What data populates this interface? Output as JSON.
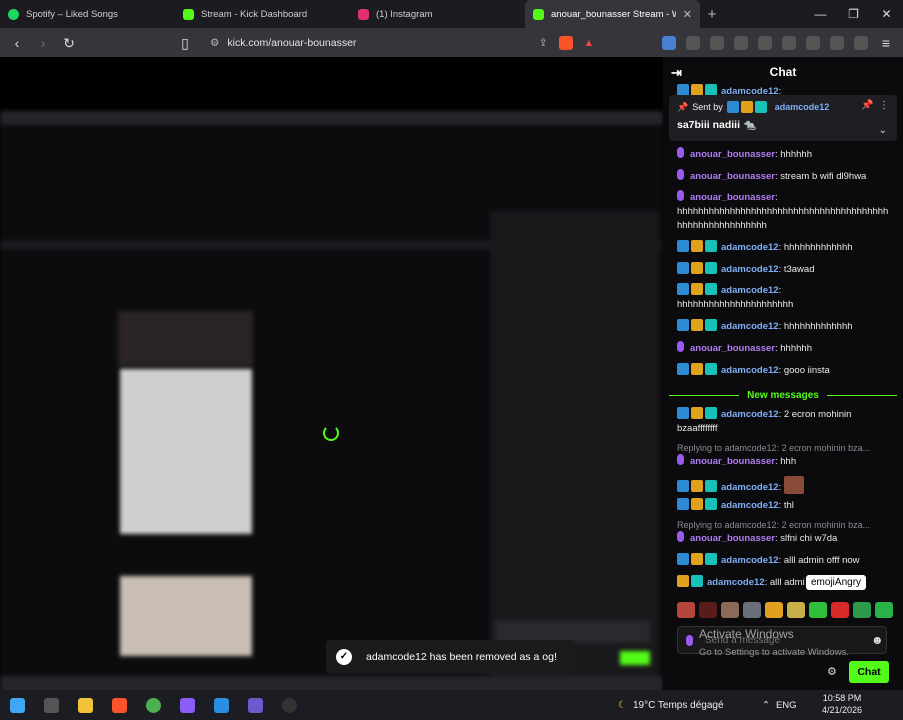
{
  "tabs": [
    {
      "title": "Spotify – Liked Songs",
      "color": "#1ed760"
    },
    {
      "title": "Stream - Kick Dashboard",
      "color": "#53fc18"
    },
    {
      "title": "(1) Instagram",
      "color": "#e1306c"
    },
    {
      "title": "anouar_bounasser Stream - Wat",
      "color": "#53fc18"
    }
  ],
  "address": {
    "url": "kick.com/anouar-bounasser"
  },
  "toast": {
    "text": "adamcode12 has been removed as a og!"
  },
  "chat": {
    "title": "Chat",
    "pinned": {
      "sent_by": "Sent by",
      "user": "adamcode12",
      "message": "sa7biii nadiii 🐀"
    },
    "top_partial": {
      "user": "adamcode12",
      "text": ":"
    },
    "messages": [
      {
        "user": "anouar_bounasser",
        "text": ": hhhhhh",
        "type": "p"
      },
      {
        "user": "anouar_bounasser",
        "text": ": stream b wifi dl9hwa",
        "type": "p"
      },
      {
        "user": "anouar_bounasser",
        "text": ":",
        "cont": "hhhhhhhhhhhhhhhhhhhhhhhhhhhhhhhhhhhhhhhhhhhhhhhhhhhhhhhhh",
        "type": "p"
      },
      {
        "user": "adamcode12",
        "text": ": hhhhhhhhhhhhh",
        "type": "b"
      },
      {
        "user": "adamcode12",
        "text": ": t3awad",
        "type": "b"
      },
      {
        "user": "adamcode12",
        "text": ":",
        "cont": "hhhhhhhhhhhhhhhhhhhhhh",
        "type": "b"
      },
      {
        "user": "adamcode12",
        "text": ": hhhhhhhhhhhhh",
        "type": "b"
      },
      {
        "user": "anouar_bounasser",
        "text": ": hhhhhh",
        "type": "p"
      },
      {
        "user": "adamcode12",
        "text": ": gooo iinsta",
        "type": "b"
      }
    ],
    "new_messages": "New messages",
    "after": [
      {
        "user": "adamcode12",
        "text": ": 2 ecron mohinin",
        "cont": "bzaaffffffff",
        "type": "b"
      },
      {
        "reply": "Replying to adamcode12: 2 ecron mohinin bza..."
      },
      {
        "user": "anouar_bounasser",
        "text": ": hhh",
        "type": "p"
      },
      {
        "user": "adamcode12",
        "text": ":",
        "type": "b",
        "emote": true
      },
      {
        "user": "adamcode12",
        "text": ": thl",
        "type": "b"
      },
      {
        "reply": "Replying to adamcode12: 2 ecron mohinin bza..."
      },
      {
        "user": "anouar_bounasser",
        "text": ": slfni chi w7da",
        "type": "p"
      },
      {
        "user": "adamcode12",
        "text": ": alll admin offf now",
        "type": "b"
      },
      {
        "user": "adamcode12",
        "text": ": alll admi",
        "type": "b"
      }
    ],
    "tooltip": "emojiAngry",
    "input_placeholder": "Send a message",
    "activate_title": "Activate Windows",
    "activate_sub": "Go to Settings to activate Windows.",
    "send_label": "Chat"
  },
  "taskbar": {
    "weather": "19°C  Temps dégagé",
    "lang": "ENG",
    "time": "10:58 PM",
    "date": "4/21/2026"
  }
}
